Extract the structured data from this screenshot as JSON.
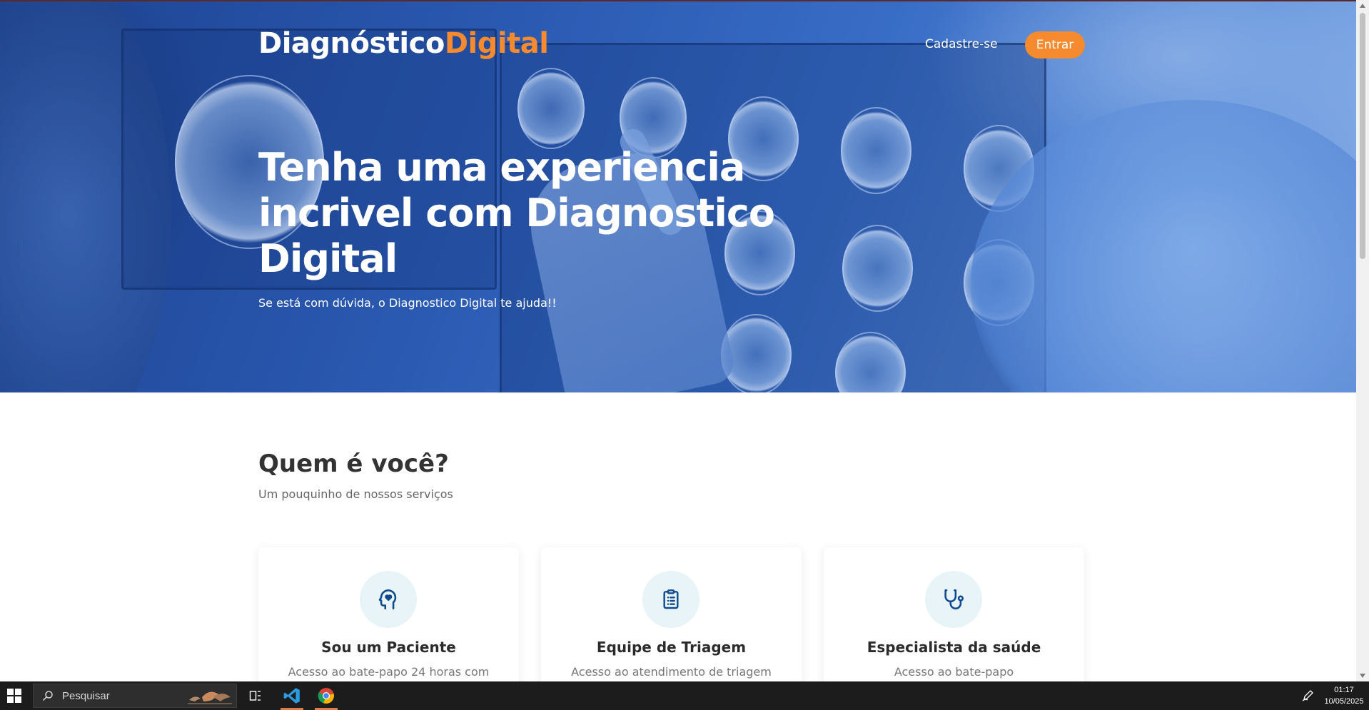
{
  "brand": {
    "part1": "Diagnóstico",
    "part2": "Digital",
    "accent_color": "#f58a2e"
  },
  "nav": {
    "signup_label": "Cadastre-se",
    "login_label": "Entrar"
  },
  "hero": {
    "title": "Tenha uma experiencia incrivel com Diagnostico Digital",
    "subtitle": "Se está com dúvida, o Diagnostico Digital te ajuda!!"
  },
  "section": {
    "title": "Quem é você?",
    "subtitle": "Um pouquinho de nossos serviços",
    "cards": [
      {
        "icon": "head-heart-icon",
        "title": "Sou um Paciente",
        "text": "Acesso ao bate-papo 24 horas com"
      },
      {
        "icon": "clipboard-icon",
        "title": "Equipe de Triagem",
        "text": "Acesso ao atendimento de triagem"
      },
      {
        "icon": "stethoscope-icon",
        "title": "Especialista da saúde",
        "text": "Acesso ao bate-papo"
      }
    ]
  },
  "taskbar": {
    "search_placeholder": "Pesquisar",
    "time": "01:17",
    "date": "10/05/2025"
  }
}
